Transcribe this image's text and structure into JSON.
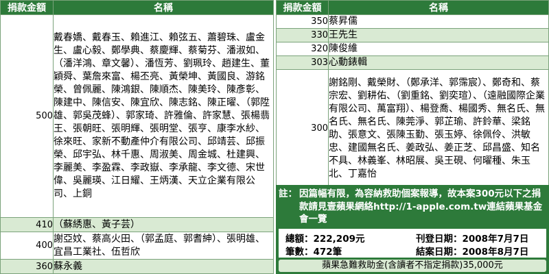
{
  "headers": {
    "amount": "捐款金額",
    "name": "名稱"
  },
  "left_rows": [
    {
      "amount": "500",
      "names": "戴春嬌、戴春玉、賴進江、賴弦五、蕭碧珠、盧金生、盧心毅、鄭學典、蔡慶輝、蔡菊芬、潘淑如、（潘洋鴻、章文馨）、潘恆芳、劉珮玲、趙建生、董穎舜、葉詹來富、楊丕亮、黃榮坤、黃國良、游銘榮、曾佩麗、陳鴻銀、陳順杰、陳美玲、陳彥彰、陳建中、陳信安、陳宜欣、陳志銘、陳正曜、（郭陞雄、郭吳茂蜂）、郭家琦、許雅倫、許家慧、張楊翡王、張朝旺、張明輝、張明堂、張亨、康李水紗、徐來旺、家新不動產仲介有限公司、邱靖芸、邱振榮、邱宇弘、林千惠、周淑美、周金城、杜建興、李麗美、李盈霖、李政嶽、李承龍、李文德、宋世偉、吳麗瑛、江日耀、王炳漢、天立企業有限公司、上銅"
    },
    {
      "amount": "410",
      "names": "（蘇綉惠、黃子芸）"
    },
    {
      "amount": "400",
      "names": "謝亞妏、蔡高火田、（郭孟庭、郭耆紳）、張明雄、宜昌工業社、伍哲欣"
    },
    {
      "amount": "360",
      "names": "蘇永義"
    }
  ],
  "right_rows": [
    {
      "amount": "350",
      "names": "蔡昇儒"
    },
    {
      "amount": "330",
      "names": "王先生"
    },
    {
      "amount": "320",
      "names": "陳俊維"
    },
    {
      "amount": "303",
      "names": "心動錶輯"
    },
    {
      "amount": "300",
      "names": "謝銘剛、戴榮財、（鄭承洋、郭霈宸）、鄭奇和、蔡宗宏、劉耕佑、（劉重銘、劉奕瑄）、（遠融國際企業有限公司、萬富翔）、楊登喬、楊國秀、無名氏、無名氏、無名氏、陳莞淨、郭芷瑜、許鈴華、梁銘助、張意文、張陳玉勤、張玉婷、徐佩伶、洪敏忠、建國無名氏、姜政弘、姜正芝、邱昌盛、知名不具、林義峯、林昭展、吳王硯、何曜種、朱玉北、丁嘉怡"
    }
  ],
  "note": {
    "label": "註：",
    "text": "因篇幅有限，為容納救助個案報導，故本案300元以下之捐款請見壹蘋果網絡http://1-apple.com.tw連結蘋果基金會一覽"
  },
  "stats": {
    "total": "總額：222,209元",
    "count": "筆數：472筆",
    "start": "刊登日期：2008年7月7日",
    "end": "結案日期：2008年8月7日"
  },
  "fund": "蘋果急難救助金(含讀者不指定捐款)35,000元",
  "colors": {
    "header_bg": "#2d7a3a",
    "row_alt": "#d9ead3",
    "border": "#7aa27a"
  }
}
